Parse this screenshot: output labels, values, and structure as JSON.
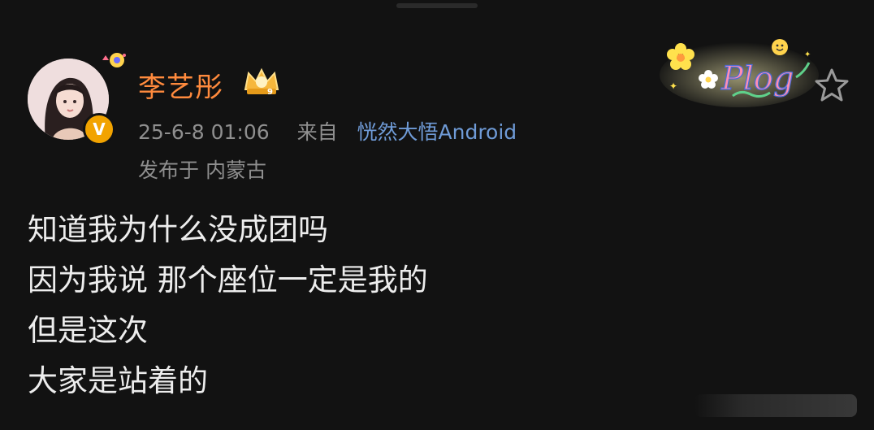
{
  "post": {
    "author": {
      "name": "李艺彤",
      "verified_badge": "V",
      "avatar_icon": "user-avatar",
      "crown_icon": "vip-crown-icon",
      "crown_level": "9"
    },
    "meta": {
      "timestamp": "25-6-8 01:06",
      "from_label": "来自",
      "source": "恍然大悟Android"
    },
    "location": "发布于 内蒙古",
    "content_lines": [
      "知道我为什么没成团吗",
      "因为我说 那个座位一定是我的",
      "但是这次",
      "大家是站着的"
    ],
    "decoration": {
      "plog_text": "Plog",
      "favorite_icon": "star-icon"
    }
  },
  "colors": {
    "background": "#121212",
    "username": "#ff8a3d",
    "meta": "#8f8f8f",
    "source_link": "#6f9bd7",
    "content": "#ededed",
    "badge": "#f2a300"
  }
}
